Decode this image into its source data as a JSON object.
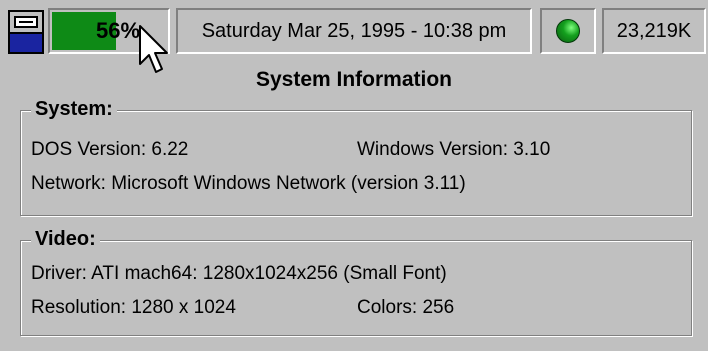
{
  "statusbar": {
    "resources_percent": "56%",
    "resources_level": 0.56,
    "datetime": "Saturday Mar 25, 1995 - 10:38 pm",
    "memory": "23,219K",
    "indicator_color": "#14a01e"
  },
  "panel": {
    "title": "System Information",
    "system": {
      "label": "System:",
      "dos_version": "DOS Version: 6.22",
      "windows_version": "Windows Version: 3.10",
      "network": "Network: Microsoft Windows Network (version 3.11)"
    },
    "video": {
      "label": "Video:",
      "driver": "Driver: ATI mach64: 1280x1024x256 (Small Font)",
      "resolution": "Resolution: 1280 x 1024",
      "colors": "Colors:  256"
    }
  },
  "icons": [
    "system-menu-icon",
    "status-led-icon",
    "mouse-pointer-icon"
  ],
  "colors": {
    "background": "#c0c0c0",
    "resource_fill": "#0e8a16",
    "system_button_fill": "#1a24a0"
  }
}
